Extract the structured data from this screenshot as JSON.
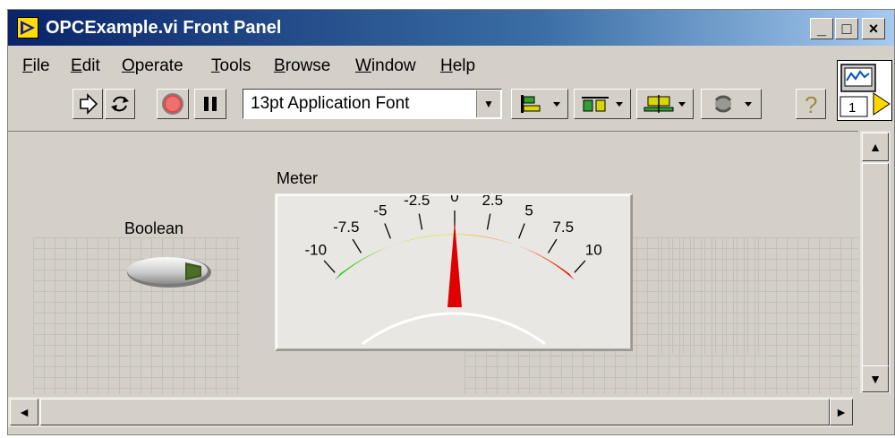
{
  "window": {
    "title": "OPCExample.vi Front Panel",
    "controls": {
      "minimize": "_",
      "maximize": "□",
      "close": "×"
    }
  },
  "menu": {
    "items": [
      {
        "label": "File",
        "accel": "F",
        "rest": "ile"
      },
      {
        "label": "Edit",
        "accel": "E",
        "rest": "dit"
      },
      {
        "label": "Operate",
        "accel": "O",
        "rest": "perate"
      },
      {
        "label": "Tools",
        "accel": "T",
        "rest": "ools"
      },
      {
        "label": "Browse",
        "accel": "B",
        "rest": "rowse"
      },
      {
        "label": "Window",
        "accel": "W",
        "rest": "indow"
      },
      {
        "label": "Help",
        "accel": "H",
        "rest": "elp"
      }
    ]
  },
  "toolbar": {
    "font_selector": "13pt Application Font",
    "buttons": [
      "run-arrow-icon",
      "run-continuously-icon",
      "abort-icon",
      "pause-icon",
      "align-objects-icon",
      "distribute-objects-icon",
      "resize-objects-icon",
      "reorder-icon",
      "context-help-icon"
    ],
    "help_glyph": "?"
  },
  "connector_pane": {
    "number": "1"
  },
  "panel": {
    "boolean": {
      "label": "Boolean",
      "state": "off"
    },
    "meter": {
      "label": "Meter",
      "min": -10,
      "max": 10,
      "value": 0,
      "scale_labels": [
        "-10",
        "-7.5",
        "-5",
        "-2.5",
        "0",
        "2.5",
        "5",
        "7.5",
        "10"
      ],
      "colors": {
        "low": "#1ec81e",
        "mid": "#f0f000",
        "high": "#e00000"
      }
    }
  },
  "scrollbars": {
    "up_glyph": "▲",
    "down_glyph": "▼",
    "left_glyph": "◄",
    "right_glyph": "►"
  }
}
